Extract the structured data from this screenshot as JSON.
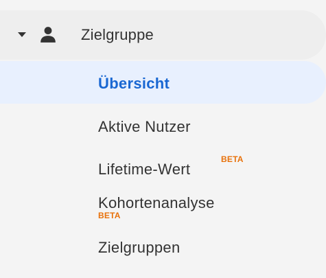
{
  "nav": {
    "section_label": "Zielgruppe",
    "items": [
      {
        "label": "Übersicht",
        "active": true
      },
      {
        "label": "Aktive Nutzer",
        "active": false
      },
      {
        "label": "Lifetime-Wert",
        "badge": "BETA",
        "active": false
      },
      {
        "label": "Kohortenanalyse",
        "badge": "BETA",
        "active": false
      },
      {
        "label": "Zielgruppen",
        "active": false
      }
    ]
  },
  "colors": {
    "active_text": "#1967d2",
    "active_bg": "#e8f0fe",
    "beta_badge": "#e8710a",
    "text": "#333333"
  },
  "icons": {
    "expand": "caret-down-icon",
    "section": "person-icon"
  }
}
